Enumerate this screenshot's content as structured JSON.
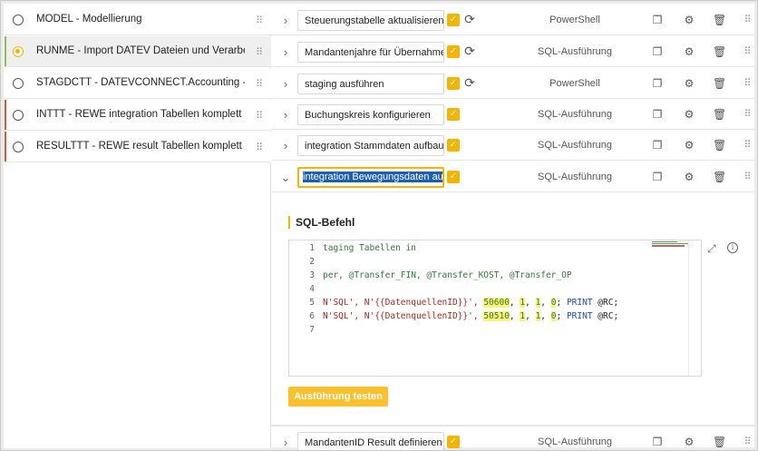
{
  "processes": [
    {
      "label": "MODEL - Modellierung",
      "selected": false,
      "active": false
    },
    {
      "label": "RUNME - Import DATEV Dateien und Verarbeitung",
      "selected": true,
      "active": true
    },
    {
      "label": "STAGDCTT - DATEVCONNECT.Accounting - staging",
      "selected": false,
      "active": false
    },
    {
      "label": "INTTT - REWE integration Tabellen komplett leeren",
      "selected": false,
      "active": false
    },
    {
      "label": "RESULTTT - REWE result Tabellen komplett leeren",
      "selected": false,
      "active": false
    }
  ],
  "steps": [
    {
      "name": "Steuerungstabelle aktualisieren",
      "type": "PowerShell",
      "checked": true,
      "repeat": true,
      "expanded": false
    },
    {
      "name": "Mandantenjahre für Übernahme de",
      "type": "SQL-Ausführung",
      "checked": true,
      "repeat": true,
      "expanded": false
    },
    {
      "name": "staging ausführen",
      "type": "PowerShell",
      "checked": true,
      "repeat": true,
      "expanded": false
    },
    {
      "name": "Buchungskreis konfigurieren",
      "type": "SQL-Ausführung",
      "checked": true,
      "repeat": false,
      "expanded": false
    },
    {
      "name": "integration Stammdaten aufbauen",
      "type": "SQL-Ausführung",
      "checked": true,
      "repeat": false,
      "expanded": false
    },
    {
      "name": "integration Bewegungsdaten aufbau",
      "type": "SQL-Ausführung",
      "checked": true,
      "repeat": false,
      "expanded": true
    },
    {
      "name": "MandantenID Result definieren",
      "type": "SQL-Ausführung",
      "checked": true,
      "repeat": false,
      "expanded": false
    }
  ],
  "sql_panel": {
    "title": "SQL-Befehl",
    "line_numbers": [
      "1",
      "2",
      "3",
      "4",
      "5",
      "6",
      "7"
    ],
    "code_lines": {
      "l1": "taging Tabellen in",
      "l3": "per, @Transfer_FIN, @Transfer_KOST, @Transfer_OP",
      "l5_str": "N'SQL', N'{{DatenquellenID}}', ",
      "l5_n1": "50600",
      "l6_str": "N'SQL', N'{{DatenquellenID}}', ",
      "l6_n1": "50510",
      "n_one": "1",
      "n_zero": "0",
      "sep": ", ",
      "tail_print": "PRINT",
      "tail_rc": " @RC;",
      "semi": ";"
    },
    "test_button": "Ausführung testen"
  },
  "icons": {
    "chevron_right": "›",
    "chevron_down": "⌄",
    "check": "✓",
    "repeat": "⟳",
    "copy": "❐",
    "gear": "⚙",
    "trash": "🗑",
    "drag": "⠿",
    "expand": "⤢",
    "info": "i"
  },
  "colors": {
    "accent": "#f4b400",
    "selection": "#1a5fb4",
    "button": "#fbc02d"
  }
}
